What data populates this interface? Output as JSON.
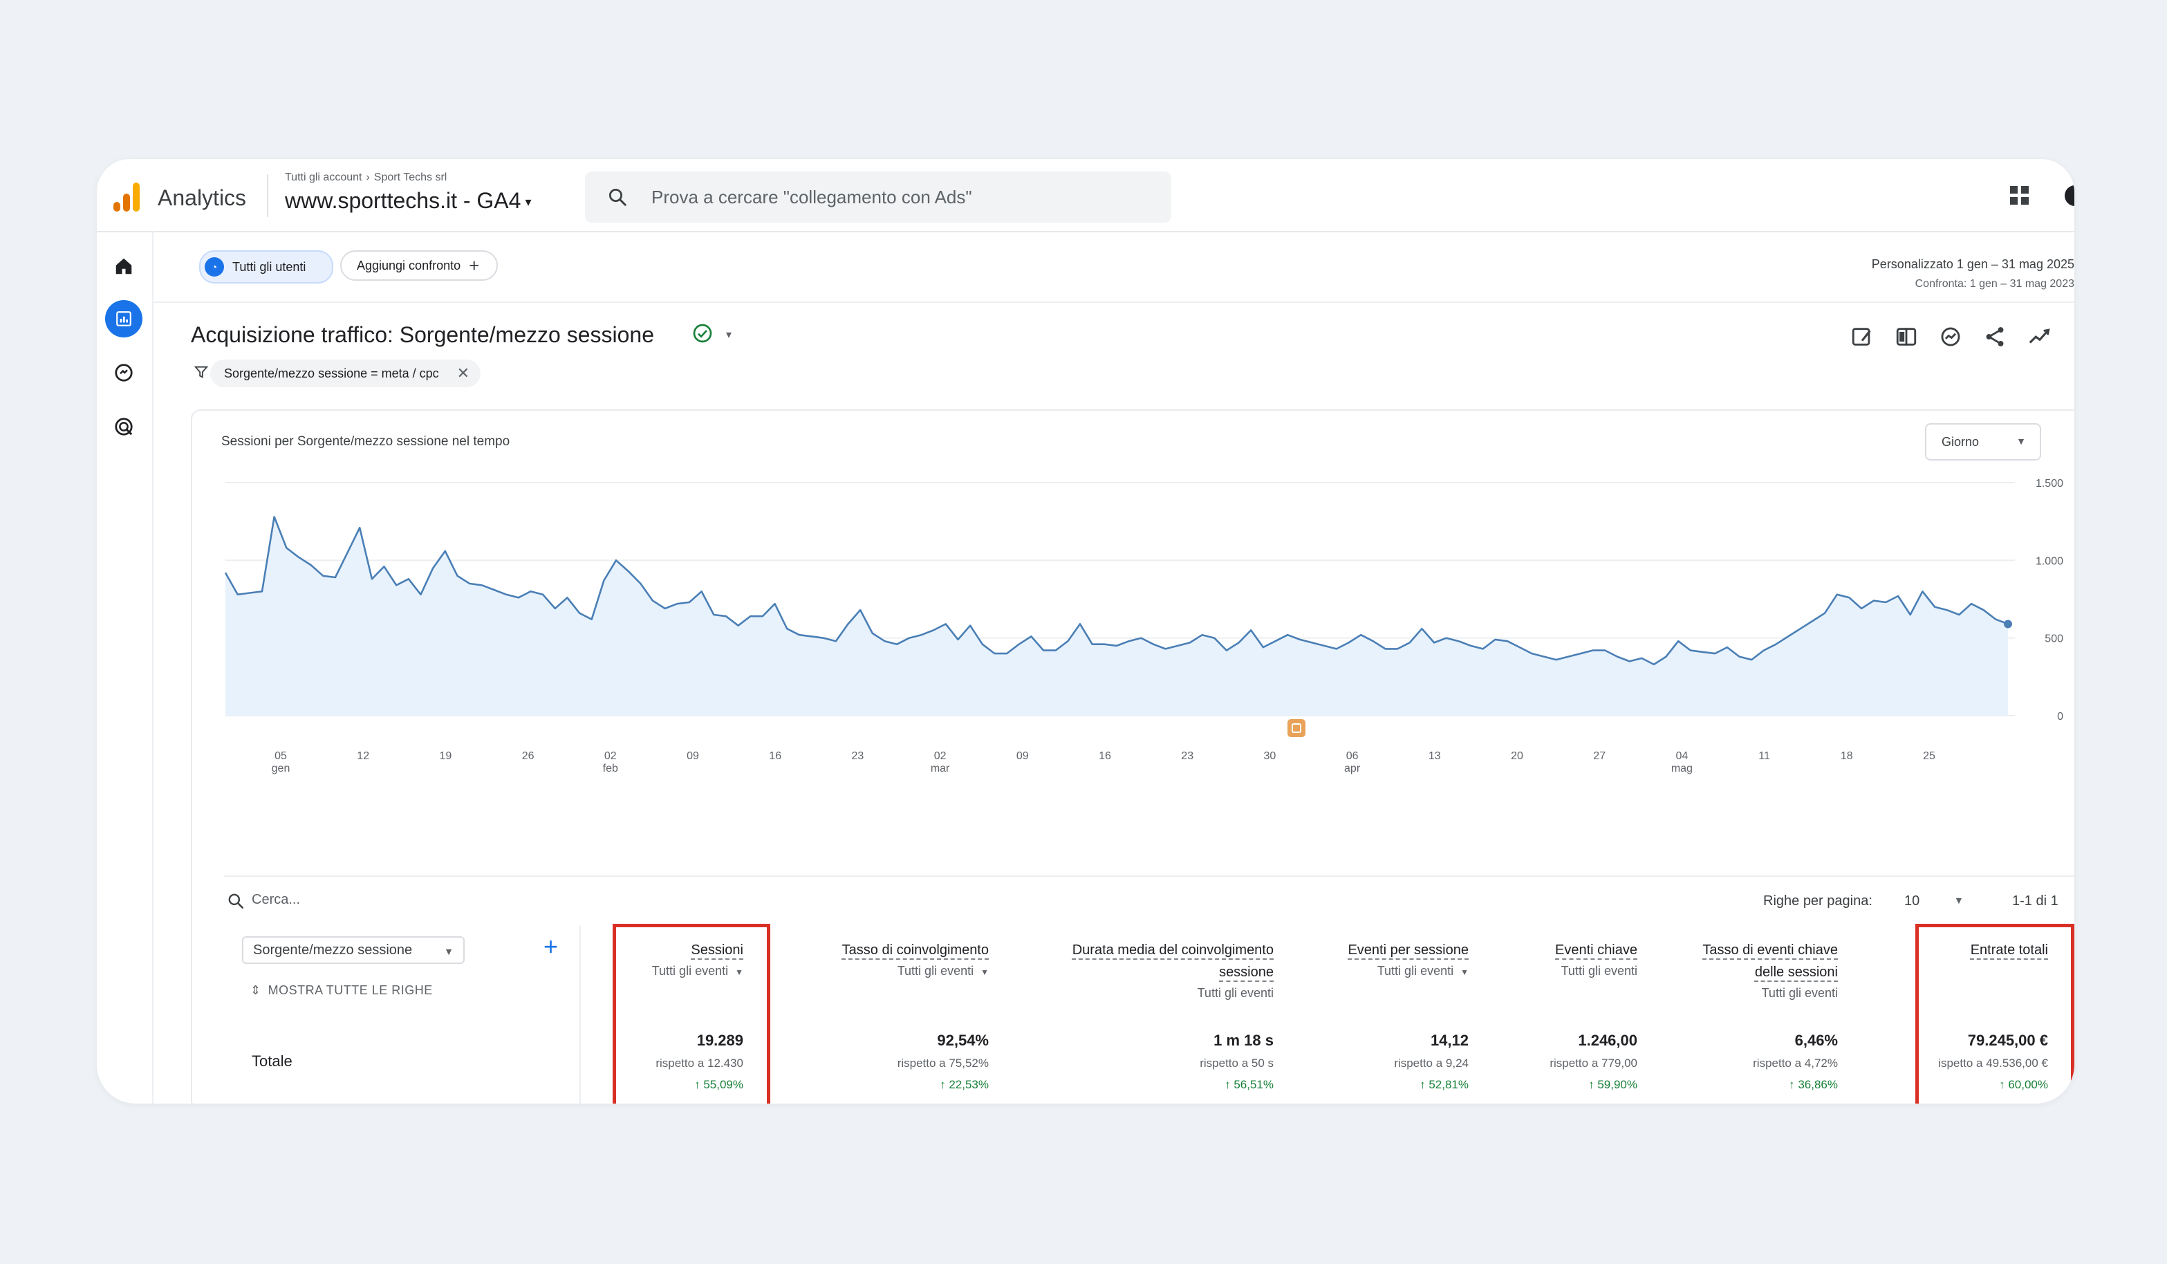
{
  "header": {
    "app_name": "Analytics",
    "breadcrumb": [
      "Tutti gli account",
      "Sport Techs srl"
    ],
    "property_name": "www.sporttechs.it - GA4",
    "search_placeholder": "Prova a cercare \"collegamento con Ads\""
  },
  "sidebar": {
    "items": [
      {
        "name": "home",
        "icon": "home-icon",
        "active": false
      },
      {
        "name": "reports",
        "icon": "reports-icon",
        "active": true
      },
      {
        "name": "explore",
        "icon": "explore-icon",
        "active": false
      },
      {
        "name": "advertising",
        "icon": "advertising-icon",
        "active": false
      }
    ]
  },
  "toolbar": {
    "segment_chip": "Tutti gli utenti",
    "compare_chip": "Aggiungi confronto",
    "date_range": "Personalizzato   1 gen – 31 mag 2025",
    "compare_range": "Confronta: 1 gen – 31 mag 2023"
  },
  "report": {
    "title": "Acquisizione traffico: Sorgente/mezzo sessione",
    "filter": "Sorgente/mezzo sessione = meta / cpc",
    "tools": [
      "edit-report-icon",
      "compare-icon",
      "insights-icon",
      "share-icon",
      "trend-icon"
    ]
  },
  "chart": {
    "granularity": "Giorno"
  },
  "chart_data": {
    "type": "area",
    "title": "Sessioni per Sorgente/mezzo sessione nel tempo",
    "xlabel": "",
    "ylabel": "",
    "ylim": [
      0,
      1500
    ],
    "yticks": [
      "0",
      "500",
      "1.000",
      "1.500"
    ],
    "xticks": [
      {
        "day": "05",
        "month": "gen"
      },
      {
        "day": "12"
      },
      {
        "day": "19"
      },
      {
        "day": "26"
      },
      {
        "day": "02",
        "month": "feb"
      },
      {
        "day": "09"
      },
      {
        "day": "16"
      },
      {
        "day": "23"
      },
      {
        "day": "02",
        "month": "mar"
      },
      {
        "day": "09"
      },
      {
        "day": "16"
      },
      {
        "day": "23"
      },
      {
        "day": "30"
      },
      {
        "day": "06",
        "month": "apr"
      },
      {
        "day": "13"
      },
      {
        "day": "20"
      },
      {
        "day": "27"
      },
      {
        "day": "04",
        "month": "mag"
      },
      {
        "day": "11"
      },
      {
        "day": "18"
      },
      {
        "day": "25"
      }
    ],
    "series": [
      {
        "color": "#4a7fb5",
        "fill": "#e8f2fd",
        "values": [
          920,
          780,
          790,
          800,
          1280,
          1080,
          1020,
          970,
          900,
          890,
          1050,
          1210,
          880,
          960,
          840,
          880,
          780,
          950,
          1060,
          900,
          850,
          840,
          810,
          780,
          760,
          800,
          780,
          690,
          760,
          660,
          620,
          870,
          1000,
          930,
          850,
          740,
          690,
          720,
          730,
          800,
          650,
          640,
          580,
          640,
          640,
          720,
          560,
          520,
          510,
          500,
          480,
          590,
          680,
          530,
          480,
          460,
          500,
          520,
          550,
          590,
          490,
          580,
          460,
          400,
          400,
          460,
          510,
          420,
          420,
          480,
          590,
          460,
          460,
          450,
          480,
          500,
          460,
          430,
          450,
          470,
          520,
          500,
          420,
          470,
          550,
          440,
          480,
          520,
          490,
          470,
          450,
          430,
          470,
          520,
          480,
          430,
          430,
          470,
          560,
          470,
          500,
          480,
          450,
          430,
          490,
          480,
          440,
          400,
          380,
          360,
          380,
          400,
          420,
          420,
          380,
          350,
          370,
          330,
          380,
          480,
          420,
          410,
          400,
          440,
          380,
          360,
          420,
          460,
          510,
          560,
          610,
          660,
          780,
          760,
          690,
          740,
          730,
          770,
          650,
          800,
          700,
          680,
          650,
          720,
          680,
          620,
          590
        ]
      }
    ],
    "annotation": "notes-icon"
  },
  "table": {
    "search_placeholder": "Cerca...",
    "rows_per_page_label": "Righe per pagina:",
    "rows_per_page": "10",
    "pagination": "1-1 di 1",
    "dimension": "Sorgente/mezzo sessione",
    "show_all_rows": "MOSTRA TUTTE LE RIGHE",
    "total_label": "Totale",
    "columns": [
      {
        "header": "Sessioni",
        "header2": "",
        "sub": "Tutti gli eventi",
        "value": "19.289",
        "compare": "rispetto a 12.430",
        "delta": "↑ 55,09%"
      },
      {
        "header": "Tasso di coinvolgimento",
        "header2": "",
        "sub": "Tutti gli eventi",
        "value": "92,54%",
        "compare": "rispetto a 75,52%",
        "delta": "↑ 22,53%"
      },
      {
        "header": "Durata media del coinvolgimento",
        "header2": "sessione",
        "sub": "Tutti gli eventi",
        "value": "1 m 18 s",
        "compare": "rispetto a 50 s",
        "delta": "↑ 56,51%"
      },
      {
        "header": "Eventi per sessione",
        "header2": "",
        "sub": "Tutti gli eventi",
        "value": "14,12",
        "compare": "rispetto a 9,24",
        "delta": "↑ 52,81%"
      },
      {
        "header": "Eventi chiave",
        "header2": "",
        "sub": "Tutti gli eventi",
        "value": "1.246,00",
        "compare": "rispetto a 779,00",
        "delta": "↑ 59,90%"
      },
      {
        "header": "Tasso di eventi chiave",
        "header2": "delle sessioni",
        "sub": "Tutti gli eventi",
        "value": "6,46%",
        "compare": "rispetto a 4,72%",
        "delta": "↑ 36,86%"
      },
      {
        "header": "Entrate totali",
        "header2": "",
        "sub": "",
        "value": "79.245,00 €",
        "compare": "ispetto a 49.536,00 €",
        "delta": "↑ 60,00%"
      }
    ]
  },
  "highlight_color": "#d93025"
}
